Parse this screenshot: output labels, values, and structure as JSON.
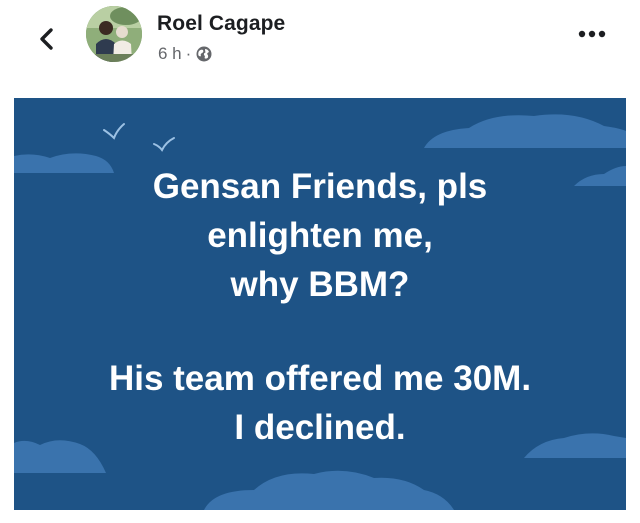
{
  "post": {
    "author": "Roel Cagape",
    "timestamp": "6 h",
    "separator": "·",
    "privacy_icon": "globe-icon",
    "back_icon": "chevron-left-icon",
    "more_icon": "more-dots-icon",
    "text_lines": [
      "Gensan Friends, pls",
      "enlighten me,",
      "why BBM?",
      "His team offered me 30M.",
      "I declined."
    ],
    "background_color": "#1e5386",
    "cloud_color": "#3a73ad",
    "text_color": "#ffffff"
  }
}
